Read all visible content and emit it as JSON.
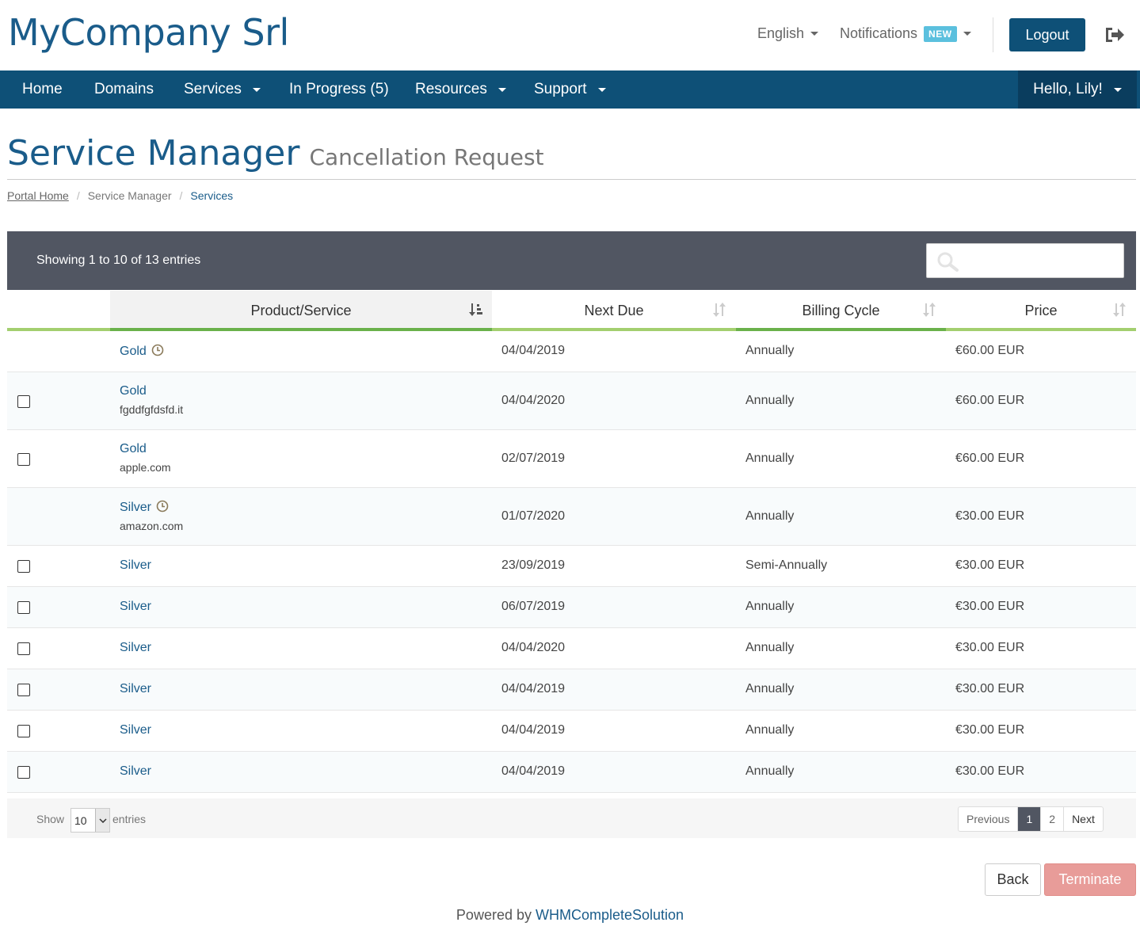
{
  "header": {
    "logo": "MyCompany Srl",
    "language": "English",
    "notifications": "Notifications",
    "notifications_badge": "NEW",
    "logout": "Logout"
  },
  "nav": {
    "items": [
      "Home",
      "Domains",
      "Services",
      "In Progress (5)",
      "Resources",
      "Support"
    ],
    "user": "Hello, Lily!"
  },
  "page": {
    "title": "Service Manager",
    "subtitle": "Cancellation Request"
  },
  "breadcrumb": [
    "Portal Home",
    "Service Manager",
    "Services"
  ],
  "table": {
    "info": "Showing 1 to 10 of 13 entries",
    "search_placeholder": "",
    "columns": [
      "Product/Service",
      "Next Due",
      "Billing Cycle",
      "Price"
    ],
    "rows": [
      {
        "checkbox": false,
        "product": "Gold",
        "domain": "",
        "pending": true,
        "next_due": "04/04/2019",
        "cycle": "Annually",
        "price": "€60.00 EUR"
      },
      {
        "checkbox": true,
        "product": "Gold",
        "domain": "fgddfgfdsfd.it",
        "pending": false,
        "next_due": "04/04/2020",
        "cycle": "Annually",
        "price": "€60.00 EUR"
      },
      {
        "checkbox": true,
        "product": "Gold",
        "domain": "apple.com",
        "pending": false,
        "next_due": "02/07/2019",
        "cycle": "Annually",
        "price": "€60.00 EUR"
      },
      {
        "checkbox": false,
        "product": "Silver",
        "domain": "amazon.com",
        "pending": true,
        "next_due": "01/07/2020",
        "cycle": "Annually",
        "price": "€30.00 EUR"
      },
      {
        "checkbox": true,
        "product": "Silver",
        "domain": "",
        "pending": false,
        "next_due": "23/09/2019",
        "cycle": "Semi-Annually",
        "price": "€30.00 EUR"
      },
      {
        "checkbox": true,
        "product": "Silver",
        "domain": "",
        "pending": false,
        "next_due": "06/07/2019",
        "cycle": "Annually",
        "price": "€30.00 EUR"
      },
      {
        "checkbox": true,
        "product": "Silver",
        "domain": "",
        "pending": false,
        "next_due": "04/04/2020",
        "cycle": "Annually",
        "price": "€30.00 EUR"
      },
      {
        "checkbox": true,
        "product": "Silver",
        "domain": "",
        "pending": false,
        "next_due": "04/04/2019",
        "cycle": "Annually",
        "price": "€30.00 EUR"
      },
      {
        "checkbox": true,
        "product": "Silver",
        "domain": "",
        "pending": false,
        "next_due": "04/04/2019",
        "cycle": "Annually",
        "price": "€30.00 EUR"
      },
      {
        "checkbox": true,
        "product": "Silver",
        "domain": "",
        "pending": false,
        "next_due": "04/04/2019",
        "cycle": "Annually",
        "price": "€30.00 EUR"
      }
    ],
    "show_label": "Show",
    "page_size": "10",
    "entries_label": "entries",
    "pager": {
      "previous": "Previous",
      "pages": [
        "1",
        "2"
      ],
      "next": "Next"
    }
  },
  "actions": {
    "back": "Back",
    "terminate": "Terminate"
  },
  "footer": {
    "powered_by": "Powered by",
    "brand": "WHMCompleteSolution"
  },
  "colors": {
    "brand": "#0e5077",
    "accent": "#a3cf6f",
    "toolbar": "#515662",
    "danger": "#e89c99"
  }
}
